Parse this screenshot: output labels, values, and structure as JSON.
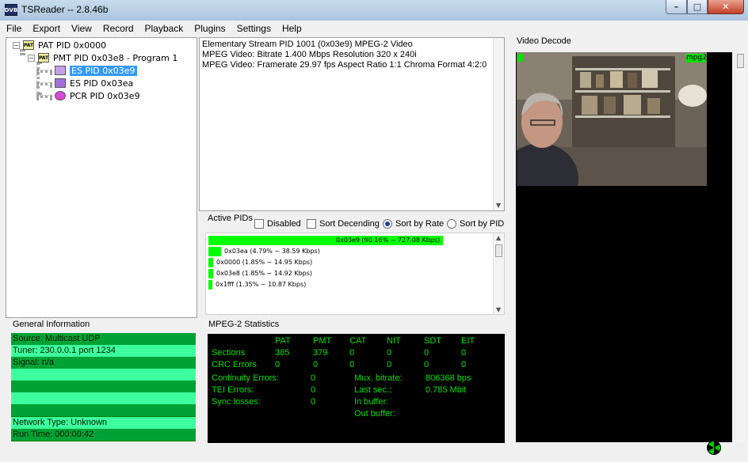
{
  "window": {
    "title": "TSReader -- 2.8.46b",
    "app_icon_text": "DVB",
    "min_glyph": "–",
    "max_glyph": "□",
    "close_glyph": "✕"
  },
  "menu": [
    "File",
    "Export",
    "View",
    "Record",
    "Playback",
    "Plugins",
    "Settings",
    "Help"
  ],
  "tree": {
    "nodes": [
      {
        "label": "PAT PID 0x0000",
        "icon": "pat-icon",
        "expander": "−"
      },
      {
        "label": "PMT PID 0x03e8 - Program 1",
        "icon": "pmt-icon",
        "expander": "−"
      },
      {
        "label": "ES PID 0x03e9",
        "icon": "video-es-icon",
        "selected": true
      },
      {
        "label": "ES PID 0x03ea",
        "icon": "audio-es-icon"
      },
      {
        "label": "PCR PID 0x03e9",
        "icon": "pcr-icon"
      }
    ],
    "icon_text": "PAT"
  },
  "info_lines": [
    "Elementary Stream PID 1001 (0x03e9) MPEG-2 Video",
    "MPEG Video: Bitrate 1.400 Mbps Resolution 320 x 240i",
    "MPEG Video: Framerate 29.97 fps Aspect Ratio 1:1 Chroma Format 4:2:0"
  ],
  "active_pids": {
    "label": "Active PIDs",
    "disabled": {
      "label": "Disabled",
      "checked": false
    },
    "sort_descending": {
      "label": "Sort Decending",
      "checked": false
    },
    "sort_by_rate": {
      "label": "Sort by Rate",
      "selected": true
    },
    "sort_by_pid": {
      "label": "Sort by PID",
      "selected": false
    },
    "bars": [
      {
        "text": "0x03e9 (90.16% ~ 727.08 Kbps)",
        "percent": 90.16
      },
      {
        "text": "0x03ea (4.79% ~ 38.59 Kbps)",
        "percent": 4.79
      },
      {
        "text": "0x0000 (1.85% ~ 14.95 Kbps)",
        "percent": 1.85
      },
      {
        "text": "0x03e8 (1.85% ~ 14.92 Kbps)",
        "percent": 1.85
      },
      {
        "text": "0x1fff (1.35% ~ 10.87 Kbps)",
        "percent": 1.35
      }
    ]
  },
  "general": {
    "label": "General Information",
    "rows": [
      "Source: Multicast UDP",
      "Tuner: 230.0.0.1 port 1234",
      "Signal: n/a",
      "",
      "",
      "",
      "",
      "Network Type: Unknown",
      "Run Time: 000:00:42"
    ]
  },
  "stats": {
    "label": "MPEG-2 Statistics",
    "columns": [
      "PAT",
      "PMT",
      "CAT",
      "NIT",
      "SDT",
      "EIT"
    ],
    "sections_label": "Sections",
    "sections": [
      "385",
      "379",
      "0",
      "0",
      "0",
      "0"
    ],
    "crc_label": "CRC Errors",
    "crc": [
      "0",
      "0",
      "0",
      "0",
      "0",
      "0"
    ],
    "continuity_label": "Continuity Errors:",
    "continuity": "0",
    "tei_label": "TEI Errors:",
    "tei": "0",
    "sync_label": "Sync losses:",
    "sync": "0",
    "mux_label": "Mux. bitrate:",
    "mux": "806368 bps",
    "last_label": "Last sec.:",
    "last": "0.785 Mbit",
    "in_label": "In buffer:",
    "out_label": "Out buffer:"
  },
  "video": {
    "label": "Video Decode",
    "codec_tag": "mpg2"
  },
  "colors": {
    "stats_text": "#00e000",
    "pid_bar": "#00ff00",
    "gen_dark": "#00a236",
    "gen_light": "#3dff9d",
    "selection": "#3399ff"
  }
}
